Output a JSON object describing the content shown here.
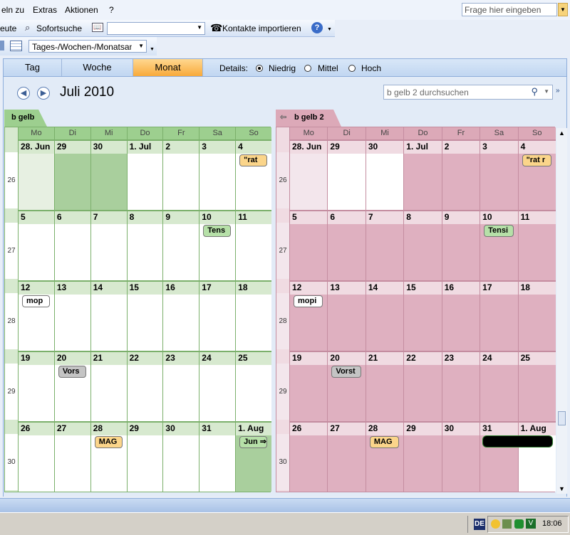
{
  "menu": {
    "items": [
      "eln zu",
      "Extras",
      "Aktionen",
      "?"
    ],
    "ask_placeholder": "Frage hier eingeben"
  },
  "toolbar": {
    "left_partial": "eute",
    "quick_search": "Sofortsuche",
    "import_contacts": "Kontakte importieren",
    "view_combo": "Tages-/Wochen-/Monatsansicht"
  },
  "view": {
    "tabs": [
      "Tag",
      "Woche",
      "Monat"
    ],
    "active_tab": "Monat",
    "details_label": "Details:",
    "details_options": [
      "Niedrig",
      "Mittel",
      "Hoch"
    ],
    "details_selected": "Niedrig"
  },
  "header": {
    "month": "Juli 2010",
    "search_placeholder": "b gelb 2 durchsuchen"
  },
  "day_names": [
    "Mo",
    "Di",
    "Mi",
    "Do",
    "Fr",
    "Sa",
    "So"
  ],
  "weeks": [
    {
      "num": "26",
      "days": [
        "28. Jun",
        "29",
        "30",
        "1. Jul",
        "2",
        "3",
        "4"
      ]
    },
    {
      "num": "27",
      "days": [
        "5",
        "6",
        "7",
        "8",
        "9",
        "10",
        "11"
      ]
    },
    {
      "num": "28",
      "days": [
        "12",
        "13",
        "14",
        "15",
        "16",
        "17",
        "18"
      ]
    },
    {
      "num": "29",
      "days": [
        "19",
        "20",
        "21",
        "22",
        "23",
        "24",
        "25"
      ]
    },
    {
      "num": "30",
      "days": [
        "26",
        "27",
        "28",
        "29",
        "30",
        "31",
        "1. Aug"
      ]
    }
  ],
  "calendars": [
    {
      "name": "b gelb",
      "colors": {
        "tab": "#9dcf8f",
        "header": "#d7e9cf",
        "bg": "#ffffff",
        "busy": "#a9cf9d",
        "past": "#e7f0e2",
        "border": "#7bb06b"
      },
      "appointments": [
        {
          "week": 0,
          "day": 6,
          "text": "\"rat",
          "color": "#fbd58a"
        },
        {
          "week": 1,
          "day": 5,
          "text": "Tens",
          "color": "#b6e0a8"
        },
        {
          "week": 2,
          "day": 0,
          "text": "mop",
          "color": "#ffffff"
        },
        {
          "week": 3,
          "day": 1,
          "text": "Vors",
          "color": "#c4c4c4"
        },
        {
          "week": 4,
          "day": 2,
          "text": "MAG",
          "color": "#fbd58a"
        },
        {
          "week": 4,
          "day": 6,
          "text": "Jun ⇒",
          "color": "#b6e0a8"
        }
      ]
    },
    {
      "name": "b gelb 2",
      "colors": {
        "tab": "#dca9b8",
        "header": "#f0dbe2",
        "bg": "#dfb0c0",
        "busy": "#ffffff",
        "past": "#f3e6ec",
        "border": "#c48da0"
      },
      "appointments": [
        {
          "week": 0,
          "day": 6,
          "text": "\"rat r",
          "color": "#fbd58a"
        },
        {
          "week": 1,
          "day": 5,
          "text": "Tensi",
          "color": "#b6e0a8"
        },
        {
          "week": 2,
          "day": 0,
          "text": "mopi",
          "color": "#ffffff"
        },
        {
          "week": 3,
          "day": 1,
          "text": "Vorst",
          "color": "#c4c4c4"
        },
        {
          "week": 4,
          "day": 2,
          "text": "MAG",
          "color": "#fbd58a"
        }
      ]
    }
  ],
  "taskbar": {
    "language": "DE",
    "time": "18:06"
  }
}
